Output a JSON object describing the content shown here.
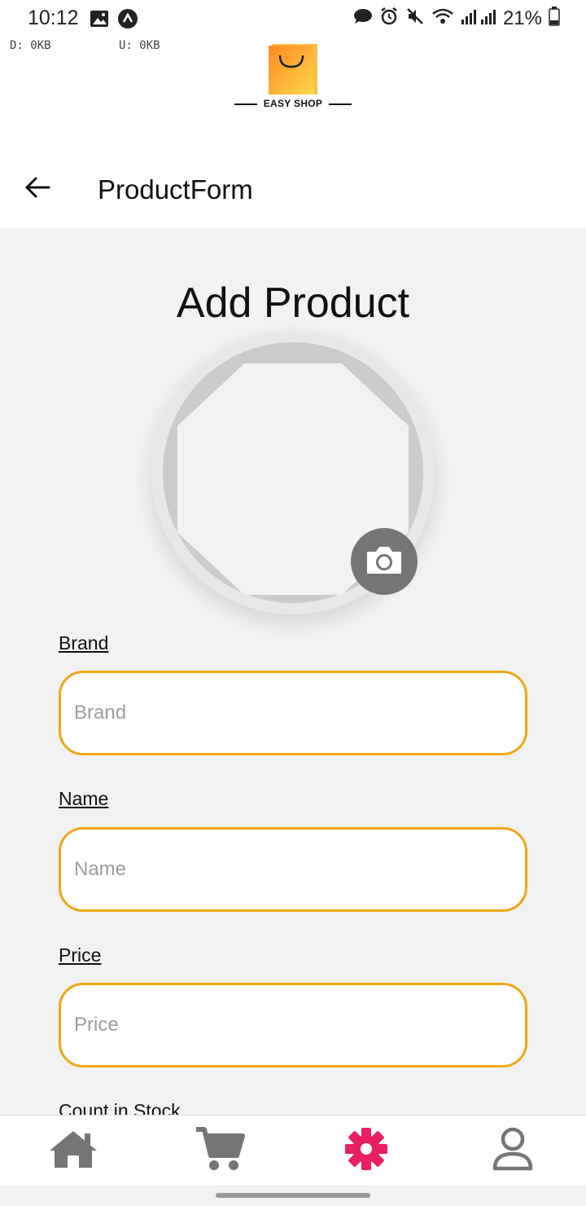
{
  "status_bar": {
    "time": "10:12",
    "battery": "21%",
    "download_meter": "D: 0KB",
    "upload_meter": "U: 0KB"
  },
  "logo": {
    "text": "EASY SHOP",
    "color_start": "#ff8a1f",
    "color_end": "#ffd84d"
  },
  "header": {
    "title": "ProductForm"
  },
  "page": {
    "title": "Add Product"
  },
  "form": {
    "brand": {
      "label": "Brand",
      "placeholder": "Brand",
      "value": ""
    },
    "name": {
      "label": "Name",
      "placeholder": "Name",
      "value": ""
    },
    "price": {
      "label": "Price",
      "placeholder": "Price",
      "value": ""
    },
    "count_in_stock": {
      "label": "Count in Stock"
    }
  },
  "colors": {
    "input_border": "#f0a616",
    "nav_active": "#e91e63",
    "nav_inactive": "#757575"
  },
  "nav": {
    "items": [
      {
        "icon": "home-icon",
        "active": false
      },
      {
        "icon": "cart-icon",
        "active": false
      },
      {
        "icon": "gear-icon",
        "active": true
      },
      {
        "icon": "user-icon",
        "active": false
      }
    ]
  }
}
